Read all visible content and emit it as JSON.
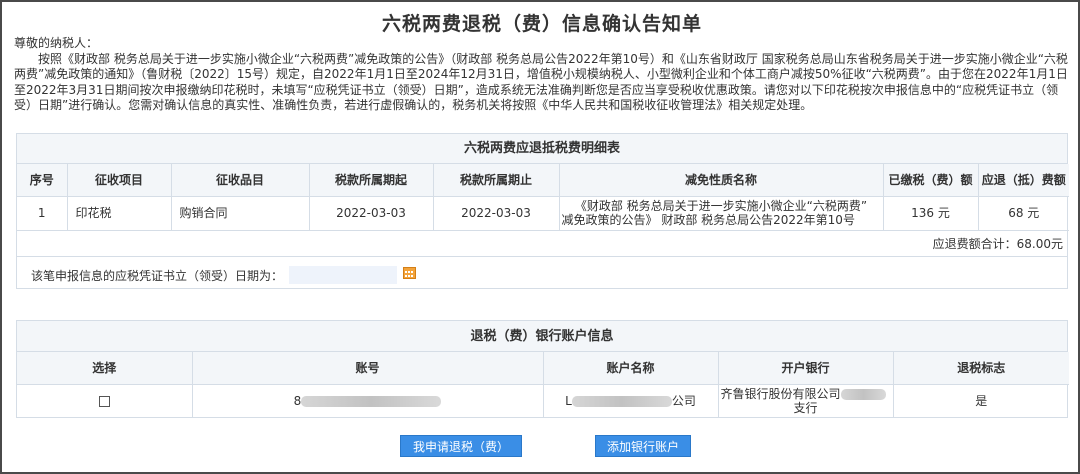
{
  "page_title": "六税两费退税（费）信息确认告知单",
  "notice": {
    "greeting": "尊敬的纳税人：",
    "body": "按照《财政部 税务总局关于进一步实施小微企业“六税两费”减免政策的公告》（财政部 税务总局公告2022年第10号）和《山东省财政厅 国家税务总局山东省税务局关于进一步实施小微企业“六税两费”减免政策的通知》（鲁财税〔2022〕15号）规定，自2022年1月1日至2024年12月31日，增值税小规模纳税人、小型微利企业和个体工商户减按50%征收“六税两费”。由于您在2022年1月1日至2022年3月31日期间按次申报缴纳印花税时，未填写“应税凭证书立（领受）日期”，造成系统无法准确判断您是否应当享受税收优惠政策。请您对以下印花税按次申报信息中的“应税凭证书立（领受）日期”进行确认。您需对确认信息的真实性、准确性负责，若进行虚假确认的，税务机关将按照《中华人民共和国税收征收管理法》相关规定处理。"
  },
  "detail": {
    "heading": "六税两费应退抵税费明细表",
    "columns": [
      "序号",
      "征收项目",
      "征收品目",
      "税款所属期起",
      "税款所属期止",
      "减免性质名称",
      "已缴税（费）额",
      "应退（抵）费额"
    ],
    "rows": [
      {
        "no": "1",
        "item": "印花税",
        "category": "购销合同",
        "start": "2022-03-03",
        "end": "2022-03-03",
        "relief_line1": "《财政部 税务总局关于进一步实施小微企业“六税两费”",
        "relief_line2": "减免政策的公告》 财政部 税务总局公告2022年第10号",
        "paid": "136 元",
        "refund": "68 元"
      }
    ],
    "total": "应退费额合计：68.00元",
    "date_label": "该笔申报信息的应税凭证书立（领受）日期为：",
    "date_value": ""
  },
  "bank": {
    "heading": "退税（费）银行账户信息",
    "columns": [
      "选择",
      "账号",
      "账户名称",
      "开户银行",
      "退税标志"
    ],
    "rows": [
      {
        "account_prefix": "8",
        "name_prefix": "L",
        "name_suffix": "公司",
        "bank_line1": "齐鲁银行股份有限公司",
        "bank_line2": "支行",
        "flag": "是"
      }
    ]
  },
  "buttons": {
    "apply": "我申请退税（费）",
    "add_account": "添加银行账户"
  },
  "colors": {
    "button_bg": "#3a8ee6",
    "header_bg": "#f3f6f9",
    "border": "#d5dde6",
    "date_input_bg": "#eef3fb",
    "calendar_icon": "#f3a33a"
  }
}
